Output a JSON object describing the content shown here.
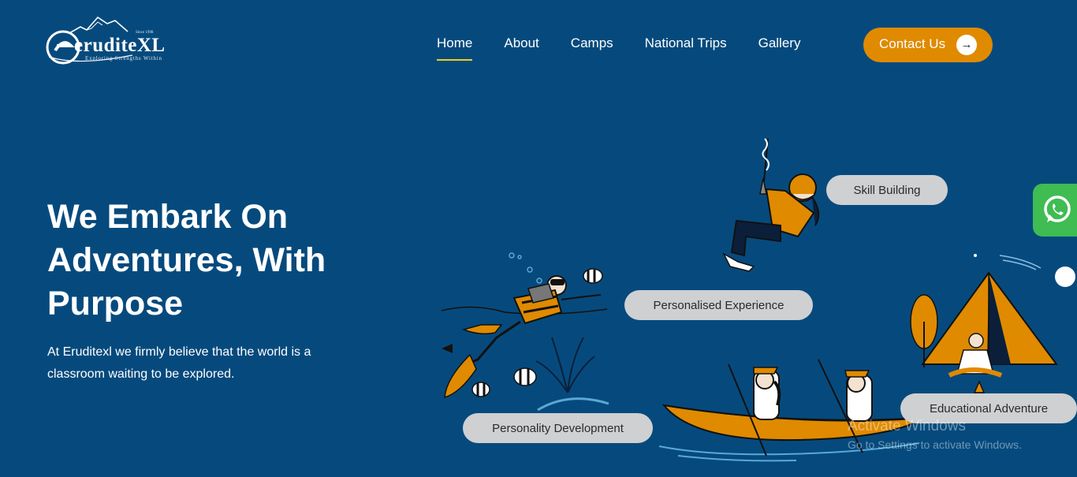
{
  "colors": {
    "background": "#064a7d",
    "accent": "#e08a00",
    "nav_underline": "#e8d21f",
    "pill": "#cfd0d2",
    "whatsapp": "#3fbc52"
  },
  "logo": {
    "name": "eruditeXL",
    "tagline": "Exploring Strengths Within",
    "since": "Since 1998"
  },
  "nav": {
    "items": [
      "Home",
      "About",
      "Camps",
      "National Trips",
      "Gallery"
    ],
    "active": "Home"
  },
  "contact_button": {
    "label": "Contact Us",
    "icon": "arrow-right-icon"
  },
  "hero": {
    "heading": "We Embark On Adventures, With Purpose",
    "subtext": "At Eruditexl we firmly believe that the world is a classroom waiting to be explored."
  },
  "pills": {
    "skill_building": "Skill Building",
    "personalised_experience": "Personalised Experience",
    "personality_development": "Personality Development",
    "educational_adventure": "Educational Adventure"
  },
  "floating": {
    "whatsapp_icon": "whatsapp-icon"
  },
  "watermark": {
    "title": "Activate Windows",
    "subtitle": "Go to Settings to activate Windows."
  }
}
